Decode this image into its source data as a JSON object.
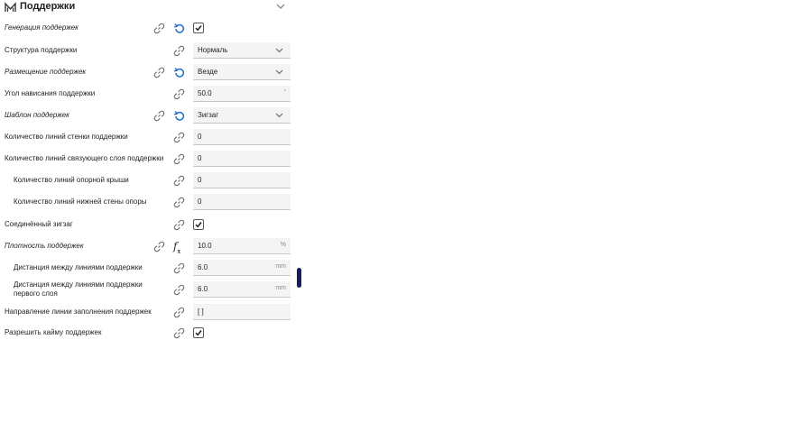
{
  "section": {
    "title": "Поддержки"
  },
  "rows": [
    {
      "label": "Генерация поддержек",
      "type": "checkbox",
      "checked": true,
      "modified": true
    },
    {
      "label": "Структура поддержки",
      "type": "select",
      "value": "Нормаль",
      "modified": false
    },
    {
      "label": "Размещение поддержек",
      "type": "select",
      "value": "Везде",
      "modified": true
    },
    {
      "label": "Угол нависания поддержки",
      "type": "number",
      "value": "50.0",
      "unit": "°",
      "modified": false
    },
    {
      "label": "Шаблон поддержек",
      "type": "select",
      "value": "Зигзаг",
      "modified": true
    },
    {
      "label": "Количество линий стенки поддержки",
      "type": "number",
      "value": "0",
      "unit": "",
      "modified": false
    },
    {
      "label": "Количество линий связующего слоя поддержки",
      "type": "number",
      "value": "0",
      "unit": "",
      "modified": false
    },
    {
      "label": "Количество линий опорной крыши",
      "type": "number",
      "value": "0",
      "unit": "",
      "modified": false
    },
    {
      "label": "Количество линий нижней стены опоры",
      "type": "number",
      "value": "0",
      "unit": "",
      "modified": false
    },
    {
      "label": "Соединённый зигзаг",
      "type": "checkbox",
      "checked": true,
      "modified": false
    },
    {
      "label": "Плотность поддержек",
      "type": "number",
      "value": "10.0",
      "unit": "%",
      "modified": true,
      "formula": true
    },
    {
      "label": "Дистанция между линиями поддержки",
      "type": "number",
      "value": "6.0",
      "unit": "mm",
      "modified": false
    },
    {
      "label": "Дистанция между линиями поддержки первого слоя",
      "type": "number",
      "value": "6.0",
      "unit": "mm",
      "modified": false
    },
    {
      "label": "Направление линии заполнения поддержек",
      "type": "text",
      "value": "[ ]",
      "unit": "",
      "modified": false
    },
    {
      "label": "Разрешить кайму поддержек",
      "type": "checkbox",
      "checked": true,
      "modified": false
    }
  ],
  "icons": {
    "section": "support-icon",
    "link": "link-icon",
    "reset": "reset-icon",
    "formula": "function-icon"
  },
  "colors": {
    "accent": "#1f6fd0",
    "scrollbar": "#1a1a5e",
    "field_bg": "#f4f4f4"
  }
}
